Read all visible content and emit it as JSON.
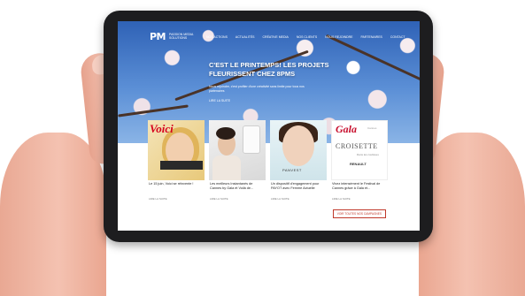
{
  "site": {
    "logo": "PM",
    "logo_subtitle": "PASSION MEDIA SOLUTIONS"
  },
  "nav": {
    "items": [
      "NOS ACTIONS",
      "ACTUALITÉS",
      "CRÉATIVE MEDIA",
      "NOS CLIENTS",
      "NOUS REJOINDRE",
      "PARTENAIRES",
      "CONTACT"
    ]
  },
  "hero": {
    "title": "C'EST LE PRINTEMPS! LES PROJETS FLEURISSENT CHEZ 8PMS",
    "subtitle": "Nous rejoindre, c'est profiter d'une créativité sans limite pour tous nos partenaires",
    "button": "LIRE LA SUITE"
  },
  "cards": [
    {
      "brand": "Voici",
      "caption": "Le 15 juin, Voici se réinvente !",
      "read_more": "LIRE LA SUITE"
    },
    {
      "brand": "",
      "caption": "Les meilleurs Instantanés de Cannes by Gala et Voilà de...",
      "read_more": "LIRE LA SUITE"
    },
    {
      "brand": "PANVEST",
      "caption": "Un dispositif d'engagement pour PAYOT avec Femme Actuelle",
      "read_more": "LIRE LA SUITE"
    },
    {
      "brand": "Gala",
      "brand_small": "Cannes",
      "title": "CROISETTE",
      "title_small": "Dans les coulisses",
      "sponsor": "RENAULT",
      "caption": "Vivez intensément le Festival de Cannes grâce à Gala et...",
      "read_more": "LIRE LA SUITE"
    }
  ],
  "cta": {
    "label": "VOIR TOUTES NOS CAMPAGNES"
  },
  "colors": {
    "accent": "#c0392b",
    "sky": "#3a6fc0",
    "bezel": "#1d1d1f"
  }
}
